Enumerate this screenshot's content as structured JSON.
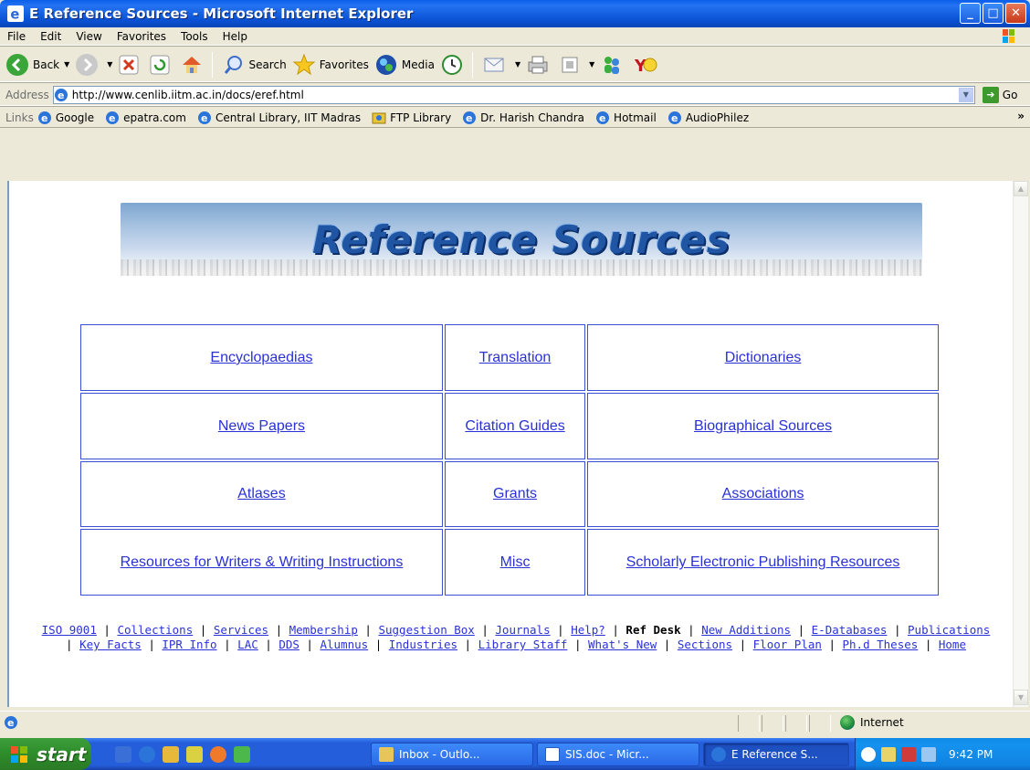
{
  "window": {
    "title": "E Reference Sources - Microsoft Internet Explorer",
    "buttons": {
      "minimize": "_",
      "maximize": "□",
      "close": "✕"
    }
  },
  "menu": [
    "File",
    "Edit",
    "View",
    "Favorites",
    "Tools",
    "Help"
  ],
  "toolbar": {
    "back_label": "Back",
    "search_label": "Search",
    "favorites_label": "Favorites",
    "media_label": "Media"
  },
  "address": {
    "label": "Address",
    "url": "http://www.cenlib.iitm.ac.in/docs/eref.html",
    "go_label": "Go"
  },
  "links": {
    "label": "Links",
    "items": [
      "Google",
      "epatra.com",
      "Central Library, IIT Madras",
      "FTP Library",
      "Dr. Harish Chandra",
      "Hotmail",
      "AudioPhilez"
    ],
    "overflow": "»"
  },
  "page": {
    "banner_text": "Reference Sources",
    "grid": [
      [
        "Encyclopaedias",
        "Translation",
        "Dictionaries"
      ],
      [
        "News Papers",
        "Citation Guides",
        "Biographical Sources"
      ],
      [
        "Atlases",
        "Grants",
        "Associations"
      ],
      [
        "Resources for Writers & Writing Instructions",
        "Misc",
        "Scholarly Electronic Publishing Resources"
      ]
    ],
    "footer_links": {
      "iso": "ISO 9001",
      "collections": "Collections",
      "services": "Services",
      "membership": "Membership",
      "suggestion": "Suggestion Box",
      "journals": "Journals",
      "help": "Help?",
      "ref_desk": "Ref Desk",
      "new_additions": "New Additions",
      "edatabases": "E-Databases",
      "publications": "Publications",
      "key_facts": "Key Facts",
      "ipr": "IPR Info",
      "lac": "LAC",
      "dds": "DDS",
      "alumnus": "Alumnus",
      "industries": "Industries",
      "library_staff": "Library Staff",
      "whats_new": "What's New",
      "sections": "Sections",
      "floor_plan": "Floor Plan",
      "phd": "Ph.d Theses",
      "home": "Home"
    }
  },
  "status": {
    "zone": "Internet"
  },
  "taskbar": {
    "start_label": "start",
    "tasks": [
      "Inbox - Outlo...",
      "SIS.doc - Micr...",
      "E Reference S..."
    ],
    "clock": "9:42 PM"
  }
}
